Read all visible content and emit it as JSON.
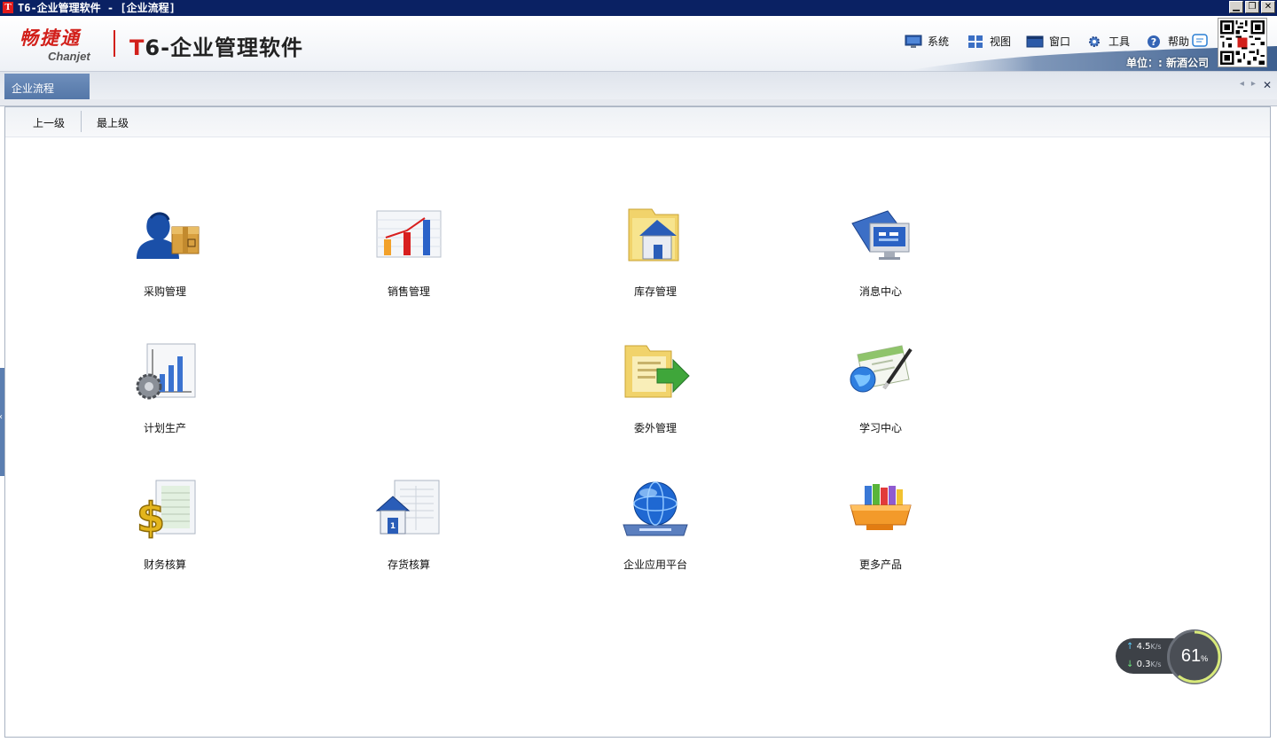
{
  "window": {
    "app_icon": "T",
    "title": "T6-企业管理软件 - [企业流程]",
    "minimize_icon": "minimize-icon",
    "restore_icon": "restore-icon",
    "close_icon": "close-icon"
  },
  "header": {
    "brand_cn": "畅捷通",
    "brand_en": "Chanjet",
    "product_t": "T",
    "product_rest": "6-企业管理软件",
    "menu": [
      {
        "label": "系统",
        "icon": "monitor-icon"
      },
      {
        "label": "视图",
        "icon": "grid-view-icon"
      },
      {
        "label": "窗口",
        "icon": "window-icon"
      },
      {
        "label": "工具",
        "icon": "gear-tools-icon"
      },
      {
        "label": "帮助",
        "icon": "help-icon"
      }
    ],
    "unit_label": "单位：: 新酒公司",
    "accent_color": "#d2201b"
  },
  "tabs": {
    "active": "企业流程",
    "prev_icon": "arrow-left-icon",
    "next_icon": "arrow-right-icon",
    "close_icon": "close-icon"
  },
  "toolbar": {
    "up_one": "上一级",
    "top_level": "最上级"
  },
  "modules": [
    {
      "label": "采购管理",
      "icon": "purchase-person-box-icon"
    },
    {
      "label": "销售管理",
      "icon": "sales-bar-chart-icon"
    },
    {
      "label": "库存管理",
      "icon": "inventory-folder-house-icon"
    },
    {
      "label": "消息中心",
      "icon": "message-center-monitor-icon"
    },
    {
      "label": "计划生产",
      "icon": "production-plan-gear-chart-icon"
    },
    {
      "label": "委外管理",
      "icon": "outsource-folder-arrow-icon"
    },
    {
      "label": "学习中心",
      "icon": "learning-globe-pen-icon"
    },
    {
      "label": "财务核算",
      "icon": "finance-dollar-icon"
    },
    {
      "label": "存货核算",
      "icon": "stock-accounting-house-icon"
    },
    {
      "label": "企业应用平台",
      "icon": "platform-globe-icon"
    },
    {
      "label": "更多产品",
      "icon": "more-products-books-icon"
    }
  ],
  "network_widget": {
    "upload": "4.5",
    "download": "0.3",
    "unit": "K/s",
    "percent": "61",
    "percent_sign": "%"
  }
}
